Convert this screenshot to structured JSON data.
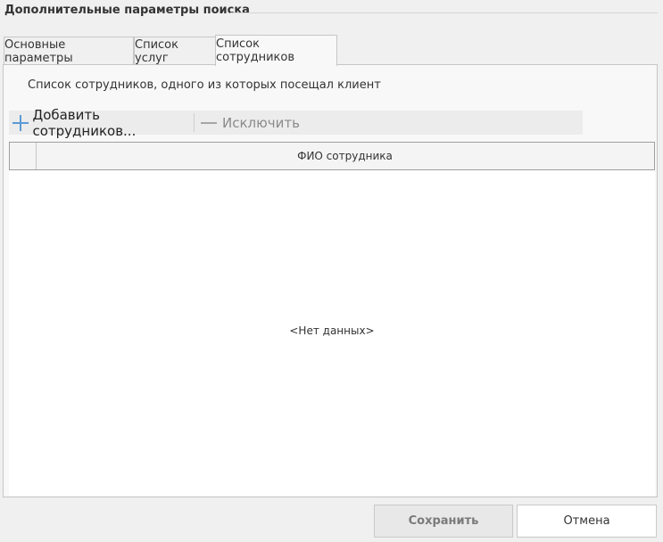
{
  "group": {
    "title": "Дополнительные параметры поиска"
  },
  "tabs": [
    {
      "label": "Основные параметры",
      "active": false
    },
    {
      "label": "Список услуг",
      "active": false
    },
    {
      "label": "Список сотрудников",
      "active": true
    }
  ],
  "panel": {
    "hint": "Список сотрудников, одного из которых посещал клиент"
  },
  "toolbar": {
    "add_label": "Добавить сотрудников...",
    "add_icon": "plus-icon",
    "remove_label": "Исключить",
    "remove_icon": "minus-icon"
  },
  "grid": {
    "columns": [
      "ФИО сотрудника"
    ],
    "rows": [],
    "empty_text": "<Нет данных>"
  },
  "buttons": {
    "save": "Сохранить",
    "cancel": "Отмена"
  },
  "colors": {
    "accent": "#5b9bd5",
    "disabled_text": "#8a8a8a"
  }
}
